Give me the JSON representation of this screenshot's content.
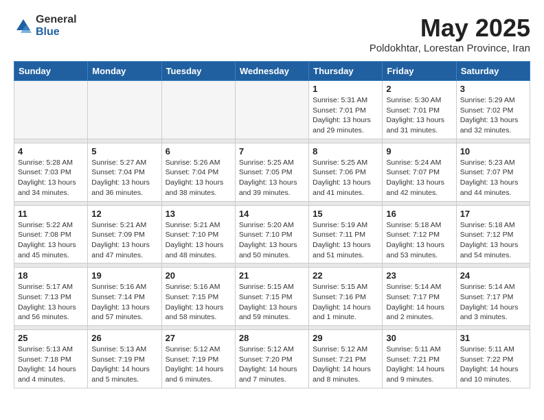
{
  "header": {
    "logo_general": "General",
    "logo_blue": "Blue",
    "month": "May 2025",
    "location": "Poldokhtar, Lorestan Province, Iran"
  },
  "weekdays": [
    "Sunday",
    "Monday",
    "Tuesday",
    "Wednesday",
    "Thursday",
    "Friday",
    "Saturday"
  ],
  "weeks": [
    [
      {
        "day": "",
        "info": ""
      },
      {
        "day": "",
        "info": ""
      },
      {
        "day": "",
        "info": ""
      },
      {
        "day": "",
        "info": ""
      },
      {
        "day": "1",
        "info": "Sunrise: 5:31 AM\nSunset: 7:01 PM\nDaylight: 13 hours\nand 29 minutes."
      },
      {
        "day": "2",
        "info": "Sunrise: 5:30 AM\nSunset: 7:01 PM\nDaylight: 13 hours\nand 31 minutes."
      },
      {
        "day": "3",
        "info": "Sunrise: 5:29 AM\nSunset: 7:02 PM\nDaylight: 13 hours\nand 32 minutes."
      }
    ],
    [
      {
        "day": "4",
        "info": "Sunrise: 5:28 AM\nSunset: 7:03 PM\nDaylight: 13 hours\nand 34 minutes."
      },
      {
        "day": "5",
        "info": "Sunrise: 5:27 AM\nSunset: 7:04 PM\nDaylight: 13 hours\nand 36 minutes."
      },
      {
        "day": "6",
        "info": "Sunrise: 5:26 AM\nSunset: 7:04 PM\nDaylight: 13 hours\nand 38 minutes."
      },
      {
        "day": "7",
        "info": "Sunrise: 5:25 AM\nSunset: 7:05 PM\nDaylight: 13 hours\nand 39 minutes."
      },
      {
        "day": "8",
        "info": "Sunrise: 5:25 AM\nSunset: 7:06 PM\nDaylight: 13 hours\nand 41 minutes."
      },
      {
        "day": "9",
        "info": "Sunrise: 5:24 AM\nSunset: 7:07 PM\nDaylight: 13 hours\nand 42 minutes."
      },
      {
        "day": "10",
        "info": "Sunrise: 5:23 AM\nSunset: 7:07 PM\nDaylight: 13 hours\nand 44 minutes."
      }
    ],
    [
      {
        "day": "11",
        "info": "Sunrise: 5:22 AM\nSunset: 7:08 PM\nDaylight: 13 hours\nand 45 minutes."
      },
      {
        "day": "12",
        "info": "Sunrise: 5:21 AM\nSunset: 7:09 PM\nDaylight: 13 hours\nand 47 minutes."
      },
      {
        "day": "13",
        "info": "Sunrise: 5:21 AM\nSunset: 7:10 PM\nDaylight: 13 hours\nand 48 minutes."
      },
      {
        "day": "14",
        "info": "Sunrise: 5:20 AM\nSunset: 7:10 PM\nDaylight: 13 hours\nand 50 minutes."
      },
      {
        "day": "15",
        "info": "Sunrise: 5:19 AM\nSunset: 7:11 PM\nDaylight: 13 hours\nand 51 minutes."
      },
      {
        "day": "16",
        "info": "Sunrise: 5:18 AM\nSunset: 7:12 PM\nDaylight: 13 hours\nand 53 minutes."
      },
      {
        "day": "17",
        "info": "Sunrise: 5:18 AM\nSunset: 7:12 PM\nDaylight: 13 hours\nand 54 minutes."
      }
    ],
    [
      {
        "day": "18",
        "info": "Sunrise: 5:17 AM\nSunset: 7:13 PM\nDaylight: 13 hours\nand 56 minutes."
      },
      {
        "day": "19",
        "info": "Sunrise: 5:16 AM\nSunset: 7:14 PM\nDaylight: 13 hours\nand 57 minutes."
      },
      {
        "day": "20",
        "info": "Sunrise: 5:16 AM\nSunset: 7:15 PM\nDaylight: 13 hours\nand 58 minutes."
      },
      {
        "day": "21",
        "info": "Sunrise: 5:15 AM\nSunset: 7:15 PM\nDaylight: 13 hours\nand 59 minutes."
      },
      {
        "day": "22",
        "info": "Sunrise: 5:15 AM\nSunset: 7:16 PM\nDaylight: 14 hours\nand 1 minute."
      },
      {
        "day": "23",
        "info": "Sunrise: 5:14 AM\nSunset: 7:17 PM\nDaylight: 14 hours\nand 2 minutes."
      },
      {
        "day": "24",
        "info": "Sunrise: 5:14 AM\nSunset: 7:17 PM\nDaylight: 14 hours\nand 3 minutes."
      }
    ],
    [
      {
        "day": "25",
        "info": "Sunrise: 5:13 AM\nSunset: 7:18 PM\nDaylight: 14 hours\nand 4 minutes."
      },
      {
        "day": "26",
        "info": "Sunrise: 5:13 AM\nSunset: 7:19 PM\nDaylight: 14 hours\nand 5 minutes."
      },
      {
        "day": "27",
        "info": "Sunrise: 5:12 AM\nSunset: 7:19 PM\nDaylight: 14 hours\nand 6 minutes."
      },
      {
        "day": "28",
        "info": "Sunrise: 5:12 AM\nSunset: 7:20 PM\nDaylight: 14 hours\nand 7 minutes."
      },
      {
        "day": "29",
        "info": "Sunrise: 5:12 AM\nSunset: 7:21 PM\nDaylight: 14 hours\nand 8 minutes."
      },
      {
        "day": "30",
        "info": "Sunrise: 5:11 AM\nSunset: 7:21 PM\nDaylight: 14 hours\nand 9 minutes."
      },
      {
        "day": "31",
        "info": "Sunrise: 5:11 AM\nSunset: 7:22 PM\nDaylight: 14 hours\nand 10 minutes."
      }
    ]
  ]
}
